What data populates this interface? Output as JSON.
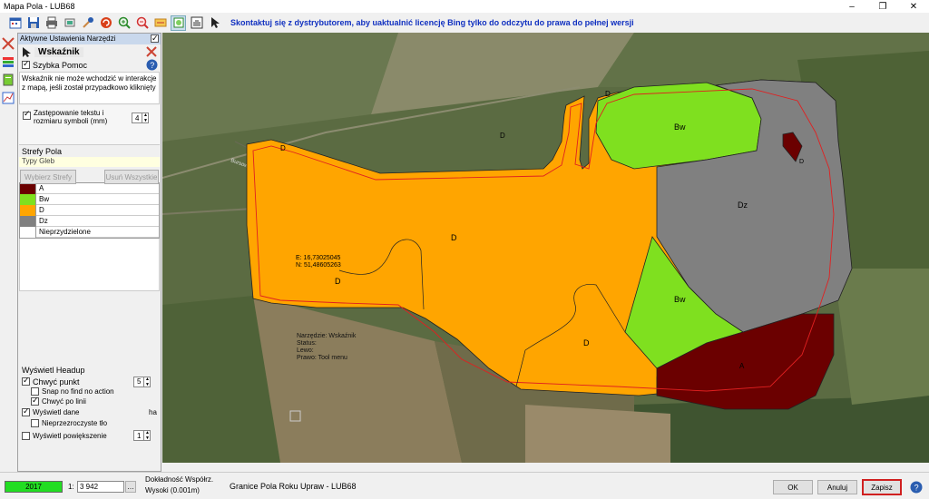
{
  "window": {
    "title": "Mapa Pola - LUB68"
  },
  "toolbar": {
    "message": "Skontaktuj się z dystrybutorem, aby uaktualnić licencję Bing tylko do odczytu do prawa do pełnej wersji"
  },
  "panel": {
    "header": "Aktywne Ustawienia Narzędzi",
    "tool_name": "Wskaźnik",
    "quick_help": "Szybka Pomoc",
    "help_text": "Wskaźnik nie może wchodzić w interakcje z mapą, jeśli został przypadkowo kliknięty",
    "replace_label": "Zastępowanie tekstu i rozmiaru symboli (mm)",
    "replace_value": "4",
    "zones_title": "Strefy Pola",
    "zones_type": "Typy Gleb",
    "btn_choose": "Wybierz Strefy",
    "btn_delete": "Usuń Wszystkie",
    "legend": [
      {
        "label": "A",
        "color": "#6b0000"
      },
      {
        "label": "Bw",
        "color": "#7fe01f"
      },
      {
        "label": "D",
        "color": "#ffa500"
      },
      {
        "label": "Dz",
        "color": "#808080"
      },
      {
        "label": "Nieprzydzielone",
        "color": "#ffffff"
      }
    ],
    "headup_title": "Wyświetl Headup",
    "catch_point": "Chwyć punkt",
    "catch_value": "5",
    "snap_label": "Snap no find no action",
    "catch_line": "Chwyć po linii",
    "show_data": "Wyświetl dane",
    "unit": "ha",
    "transparent": "Nieprzezroczyste tło",
    "show_zoom": "Wyświetl powiększenie",
    "zoom_value": "1"
  },
  "map": {
    "road": "Bursowa Mała",
    "coord_e": "E: 16,73025045",
    "coord_n": "N: 51,48605263",
    "zone_labels": [
      "D",
      "D",
      "D",
      "D",
      "D",
      "D",
      "Bw",
      "Bw",
      "Dz",
      "A"
    ],
    "info_lines": [
      "Narzędzie: Wskaźnik",
      "Status:",
      "Lewo:",
      "Prawo: Tool menu"
    ]
  },
  "status": {
    "year": "2017",
    "scale_prefix": "1:",
    "scale": "3 942",
    "accuracy_line1": "Dokładność Współrz.",
    "accuracy_line2": "Wysoki (0.001m)",
    "field_name": "Granice Pola Roku Upraw - LUB68",
    "ok": "OK",
    "cancel": "Anuluj",
    "save": "Zapisz"
  }
}
